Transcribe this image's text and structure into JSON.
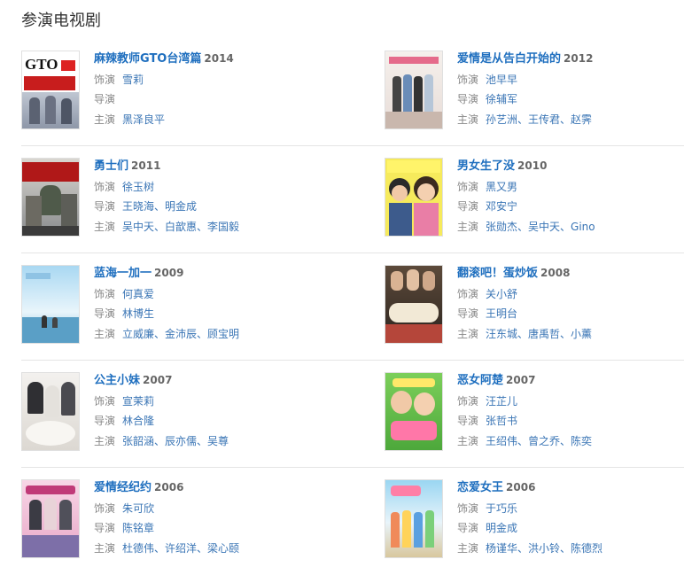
{
  "section_title": "参演电视剧",
  "labels": {
    "actor": "饰演",
    "director": "导演",
    "cast": "主演"
  },
  "colors": {
    "link": "#1f6fbf",
    "meta_value": "#3a75b5",
    "divider": "#e5e5e5"
  },
  "shows": [
    {
      "title": "麻辣教师GTO台湾篇",
      "year": "2014",
      "role": "雪莉",
      "director": "",
      "cast": "黑泽良平",
      "poster_icon": "gto-poster"
    },
    {
      "title": "爱情是从告白开始的",
      "year": "2012",
      "role": "池早早",
      "director": "徐辅军",
      "cast": "孙艺洲、王传君、赵霁",
      "poster_icon": "love-confession-poster"
    },
    {
      "title": "勇士们",
      "year": "2011",
      "role": "徐玉树",
      "director": "王晓海、明金成",
      "cast": "吴中天、白歆惠、李国毅",
      "poster_icon": "warriors-poster"
    },
    {
      "title": "男女生了没",
      "year": "2010",
      "role": "黑又男",
      "director": "邓安宁",
      "cast": "张勋杰、吴中天、Gino",
      "poster_icon": "boys-girls-poster"
    },
    {
      "title": "蓝海一加一",
      "year": "2009",
      "role": "何真爱",
      "director": "林博生",
      "cast": "立威廉、金沛辰、顾宝明",
      "poster_icon": "blue-sea-poster"
    },
    {
      "title": "翻滚吧！蛋炒饭",
      "year": "2008",
      "role": "关小舒",
      "director": "王明台",
      "cast": "汪东城、唐禹哲、小薰",
      "poster_icon": "fried-rice-poster"
    },
    {
      "title": "公主小妹",
      "year": "2007",
      "role": "宣茉莉",
      "director": "林合隆",
      "cast": "张韶涵、辰亦儒、吴尊",
      "poster_icon": "princess-poster"
    },
    {
      "title": "恶女阿楚",
      "year": "2007",
      "role": "汪芷儿",
      "director": "张哲书",
      "cast": "王绍伟、曾之乔、陈奕",
      "poster_icon": "bad-girl-poster"
    },
    {
      "title": "爱情经纪约",
      "year": "2006",
      "role": "朱可欣",
      "director": "陈铭章",
      "cast": "杜德伟、许绍洋、梁心颐",
      "poster_icon": "love-contract-poster"
    },
    {
      "title": "恋爱女王",
      "year": "2006",
      "role": "于巧乐",
      "director": "明金成",
      "cast": "杨谨华、洪小铃、陈德烈",
      "poster_icon": "love-queen-poster"
    }
  ]
}
